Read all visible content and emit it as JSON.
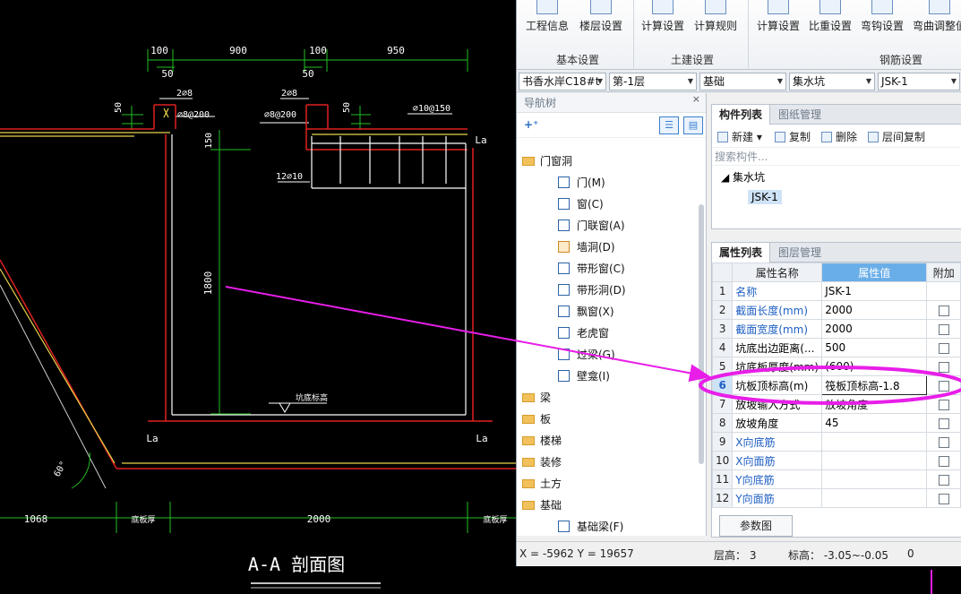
{
  "ribbon": {
    "buttons": [
      {
        "label": "工程信息",
        "icon": "project-info-icon"
      },
      {
        "label": "楼层设置",
        "icon": "floor-settings-icon"
      },
      {
        "label": "计算设置",
        "icon": "calc-settings-icon"
      },
      {
        "label": "计算规则",
        "icon": "calc-rules-icon"
      },
      {
        "label": "计算设置",
        "icon": "rebar-calc-settings-icon"
      },
      {
        "label": "比重设置",
        "icon": "density-settings-icon"
      },
      {
        "label": "弯钩设置",
        "icon": "hook-settings-icon"
      },
      {
        "label": "弯曲调整值",
        "icon": "bend-adjust-icon"
      }
    ],
    "groups": [
      "基本设置",
      "土建设置",
      "钢筋设置"
    ]
  },
  "toolbar": {
    "project": "书香水岸C18#t",
    "floor": "第-1层",
    "category": "基础",
    "type": "集水坑",
    "component": "JSK-1"
  },
  "nav": {
    "title": "导航树",
    "close": "×",
    "items": [
      {
        "label": "门窗洞",
        "kind": "folder"
      },
      {
        "label": "门(M)",
        "kind": "item"
      },
      {
        "label": "窗(C)",
        "kind": "item"
      },
      {
        "label": "门联窗(A)",
        "kind": "item"
      },
      {
        "label": "墙洞(D)",
        "kind": "item"
      },
      {
        "label": "带形窗(C)",
        "kind": "item"
      },
      {
        "label": "带形洞(D)",
        "kind": "item"
      },
      {
        "label": "飘窗(X)",
        "kind": "item"
      },
      {
        "label": "老虎窗",
        "kind": "item"
      },
      {
        "label": "过梁(G)",
        "kind": "item"
      },
      {
        "label": "壁龛(I)",
        "kind": "item"
      },
      {
        "label": "梁",
        "kind": "folder"
      },
      {
        "label": "板",
        "kind": "folder"
      },
      {
        "label": "楼梯",
        "kind": "folder"
      },
      {
        "label": "装修",
        "kind": "folder"
      },
      {
        "label": "土方",
        "kind": "folder"
      },
      {
        "label": "基础",
        "kind": "folder"
      },
      {
        "label": "基础梁(F)",
        "kind": "item"
      }
    ]
  },
  "components": {
    "tabs": [
      "构件列表",
      "图纸管理"
    ],
    "commands": [
      "新建",
      "复制",
      "删除",
      "层间复制"
    ],
    "search_placeholder": "搜索构件...",
    "tree_root": "集水坑",
    "tree_child": "JSK-1"
  },
  "properties": {
    "tabs": [
      "属性列表",
      "图层管理"
    ],
    "headers": [
      "属性名称",
      "属性值",
      "附加"
    ],
    "rows": [
      {
        "n": "1",
        "name": "名称",
        "value": "JSK-1",
        "blue": true,
        "check": false
      },
      {
        "n": "2",
        "name": "截面长度(mm)",
        "value": "2000",
        "blue": true,
        "check": true
      },
      {
        "n": "3",
        "name": "截面宽度(mm)",
        "value": "2000",
        "blue": true,
        "check": true
      },
      {
        "n": "4",
        "name": "坑底出边距离(...",
        "value": "500",
        "blue": false,
        "check": true
      },
      {
        "n": "5",
        "name": "坑底板厚度(mm)",
        "value": "(600)",
        "blue": false,
        "check": true
      },
      {
        "n": "6",
        "name": "坑板顶标高(m)",
        "value": "筏板顶标高-1.8",
        "blue": false,
        "check": true
      },
      {
        "n": "7",
        "name": "放坡输入方式",
        "value": "放坡角度",
        "blue": false,
        "check": true
      },
      {
        "n": "8",
        "name": "放坡角度",
        "value": "45",
        "blue": false,
        "check": true
      },
      {
        "n": "9",
        "name": "X向底筋",
        "value": "",
        "blue": true,
        "check": true
      },
      {
        "n": "10",
        "name": "X向面筋",
        "value": "",
        "blue": true,
        "check": true
      },
      {
        "n": "11",
        "name": "Y向底筋",
        "value": "",
        "blue": true,
        "check": true
      },
      {
        "n": "12",
        "name": "Y向面筋",
        "value": "",
        "blue": true,
        "check": true
      }
    ],
    "ref_button": "参数图"
  },
  "status": {
    "coords": "X = -5962 Y = 19657",
    "floor_height": "层高： 3",
    "elevation": "标高： -3.05~-0.05",
    "extra": "0"
  },
  "drawing": {
    "dims_top": [
      "100",
      "50",
      "900",
      "100",
      "50",
      "950"
    ],
    "rebar_1": "2⌀8",
    "rebar_2": "⌀8@200",
    "rebar_3": "2⌀8",
    "rebar_4": "⌀8@200",
    "rebar_5": "⌀10@150",
    "rebar_6": "12⌀10",
    "dim_50a": "50",
    "dim_50b": "50",
    "dim_150": "150",
    "dim_1800": "1800",
    "la_1": "La",
    "la_2": "La",
    "la_3": "La",
    "floor_label": "坑底标高",
    "angle": "60°",
    "bottom_dims": [
      "1068",
      "底板厚",
      "2000",
      "底板厚"
    ],
    "section_title": "A-A 剖面图"
  },
  "colors": {
    "cad_bg": "#000000",
    "red_line": "#e02020",
    "green_dim": "#22c022",
    "white_line": "#ffffff",
    "yellow": "#e8d44a",
    "magenta": "#e81ee8",
    "header_blue": "#6aaee8"
  }
}
